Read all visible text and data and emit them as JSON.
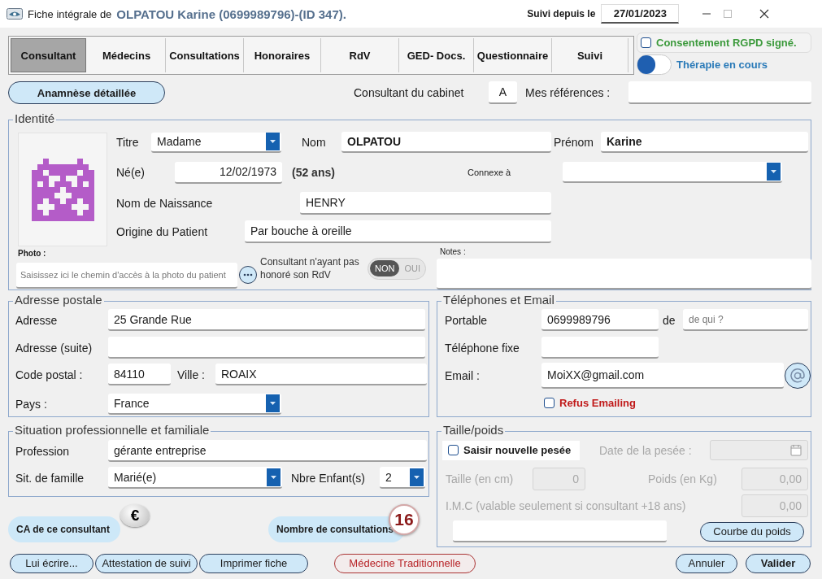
{
  "window": {
    "title": "Fiche intégrale de",
    "patient": "OLPATOU Karine (0699989796)-(ID 347).",
    "follow_label": "Suivi depuis le",
    "follow_date": "27/01/2023"
  },
  "tabs": [
    {
      "label": "Consultant",
      "selected": true
    },
    {
      "label": "Médecins",
      "selected": false
    },
    {
      "label": "Consultations",
      "selected": false
    },
    {
      "label": "Honoraires",
      "selected": false
    },
    {
      "label": "RdV",
      "selected": false
    },
    {
      "label": "GED- Docs.",
      "selected": false
    },
    {
      "label": "Questionnaire",
      "selected": false
    },
    {
      "label": "Suivi",
      "selected": false
    }
  ],
  "rgpd": {
    "label": "Consentement RGPD signé.",
    "checked": false
  },
  "therapy": {
    "label": "Thérapie en cours",
    "on": false
  },
  "anamnesis_button": "Anamnèse détaillée",
  "cabinet": {
    "label": "Consultant du cabinet",
    "value": "A"
  },
  "references": {
    "label": "Mes références :"
  },
  "identity": {
    "legend": "Identité",
    "title": {
      "label": "Titre",
      "value": "Madame"
    },
    "last_name": {
      "label": "Nom",
      "value": "OLPATOU"
    },
    "first_name": {
      "label": "Prénom",
      "value": "Karine"
    },
    "birth": {
      "label": "Né(e)",
      "value": "12/02/1973",
      "age": "(52 ans)"
    },
    "related": {
      "label": "Connexe à"
    },
    "birth_name": {
      "label": "Nom de Naissance",
      "value": "HENRY"
    },
    "origin": {
      "label": "Origine du Patient",
      "value": "Par bouche à oreille"
    },
    "photo": {
      "label": "Photo :",
      "placeholder": "Saisissez ici le chemin d'accès à la photo du patient"
    },
    "no_show": {
      "label": "Consultant n'ayant pas honoré son RdV",
      "options": [
        {
          "label": "NON",
          "selected": true
        },
        {
          "label": "OUI",
          "selected": false
        }
      ]
    },
    "notes": {
      "label": "Notes :"
    }
  },
  "address": {
    "legend": "Adresse postale",
    "street": {
      "label": "Adresse",
      "value": "25 Grande Rue"
    },
    "street2": {
      "label": "Adresse (suite)"
    },
    "postcode": {
      "label": "Code postal :",
      "value": "84110"
    },
    "city": {
      "label": "Ville :",
      "value": "ROAIX"
    },
    "country": {
      "label": "Pays :",
      "value": "France"
    }
  },
  "phones": {
    "legend": "Téléphones et Email",
    "mobile": {
      "label": "Portable",
      "value": "0699989796"
    },
    "owner": {
      "label": "de",
      "placeholder": "de qui ?"
    },
    "landline": {
      "label": "Téléphone fixe"
    },
    "email": {
      "label": "Email :",
      "value": "MoiXX@gmail.com"
    },
    "refuse_mailing": {
      "label": "Refus Emailing",
      "checked": false
    }
  },
  "situation": {
    "legend": "Situation professionnelle et familiale",
    "profession": {
      "label": "Profession",
      "value": "gérante entreprise"
    },
    "family": {
      "label": "Sit. de famille",
      "value": "Marié(e)"
    },
    "children": {
      "label": "Nbre Enfant(s)",
      "value": "2"
    }
  },
  "revenue": {
    "label": "CA de ce consultant",
    "symbol": "€"
  },
  "consultations": {
    "label": "Nombre de consultations",
    "count": "16"
  },
  "weight": {
    "legend": "Taille/poids",
    "new_weighing": {
      "label": "Saisir nouvelle pesée",
      "checked": false
    },
    "date": {
      "label": "Date de la pesée :",
      "disabled": true
    },
    "height": {
      "label": "Taille (en cm)",
      "value": "0",
      "disabled": true
    },
    "mass": {
      "label": "Poids (en Kg)",
      "value": "0,00",
      "disabled": true
    },
    "bmi": {
      "label": "I.M.C (valable seulement si consultant +18 ans)",
      "value": "0,00",
      "disabled": true
    },
    "curve_button": "Courbe du poids"
  },
  "footer": {
    "left_buttons": [
      "Lui écrire...",
      "Attestation de suivi",
      "Imprimer fiche"
    ],
    "medicine_button": "Médecine Traditionnelle",
    "cancel_button": "Annuler",
    "validate_button": "Valider"
  }
}
